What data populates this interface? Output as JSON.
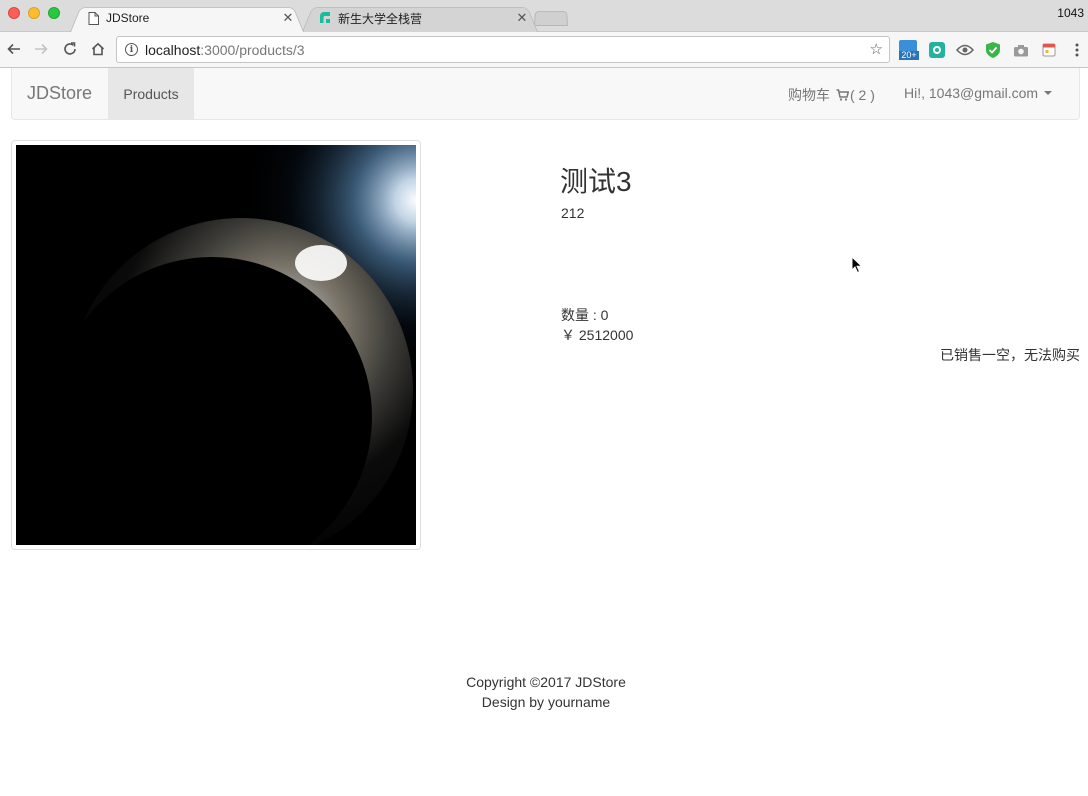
{
  "browser": {
    "tabs": [
      {
        "title": "JDStore",
        "icon": "page-icon",
        "active": true
      },
      {
        "title": "新生大学全栈营",
        "icon": "brand-logo-icon",
        "active": false
      }
    ],
    "clock": "1043",
    "url_host": "localhost",
    "url_path": ":3000/products/3",
    "extension_badge": "20+"
  },
  "navbar": {
    "brand": "JDStore",
    "products_link": "Products",
    "cart_label": "购物车",
    "cart_count": "( 2 )",
    "user_greeting": "Hi!, 1043@gmail.com"
  },
  "product": {
    "image_alt": "planet",
    "title": "测试3",
    "description": "212",
    "quantity": "数量 : 0",
    "price": "￥ 2512000",
    "status": "已销售一空，无法购买"
  },
  "footer": {
    "copyright": "Copyright ©2017 JDStore",
    "design": "Design by yourname"
  },
  "colors": {
    "navbar_bg": "#f8f8f8",
    "active_nav_bg": "#e7e7e7",
    "link_gray": "#777777",
    "text": "#333333"
  }
}
